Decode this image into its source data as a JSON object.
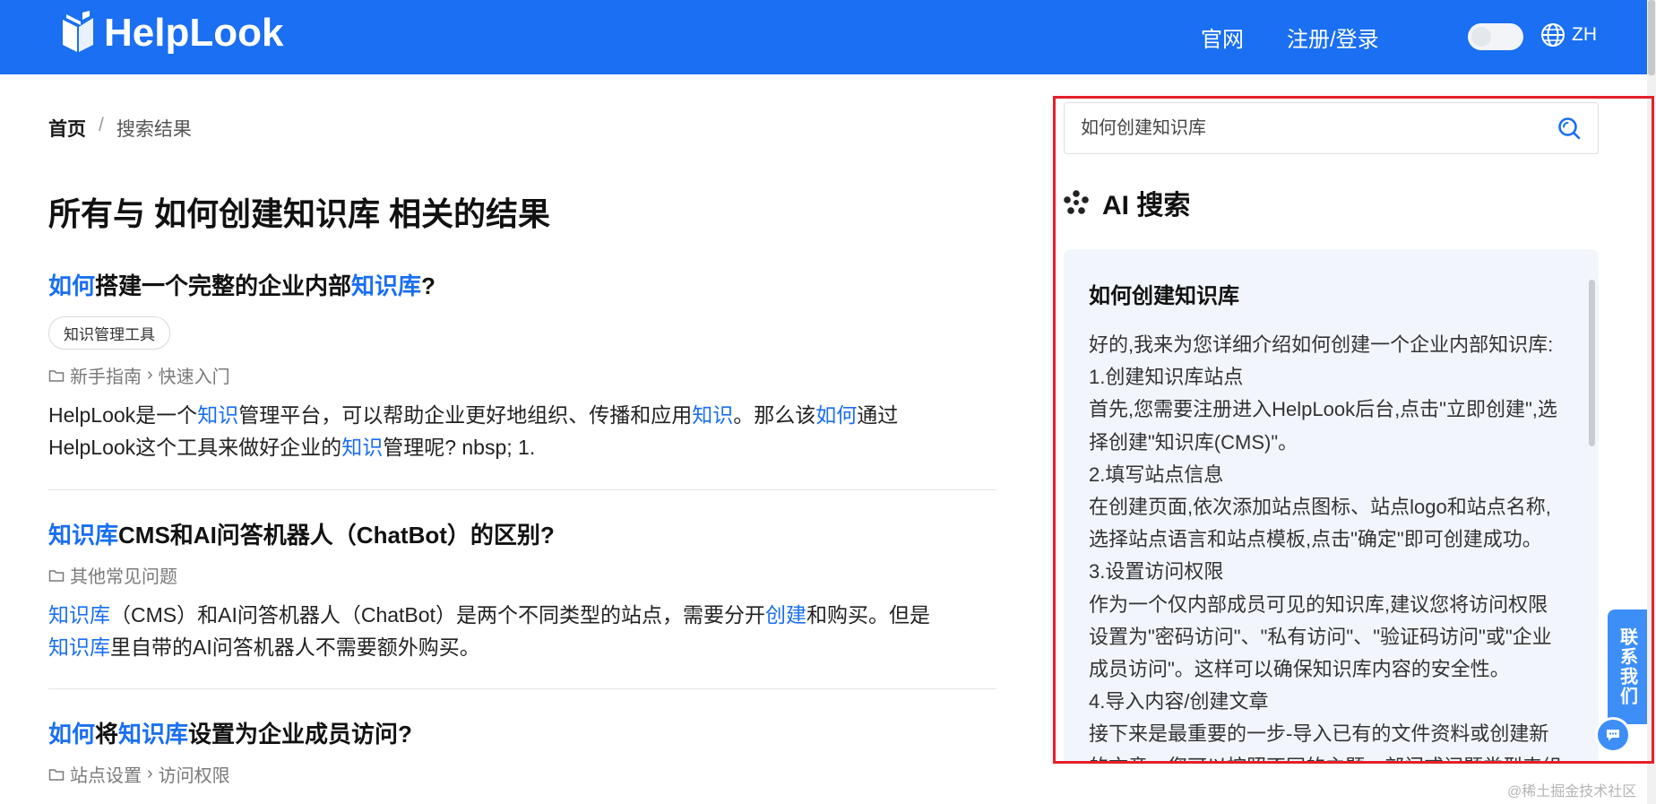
{
  "header": {
    "logo_text": "HelpLook",
    "nav_official": "官网",
    "nav_login": "注册/登录",
    "lang": "ZH",
    "brand_color": "#1a6ff2"
  },
  "breadcrumb": {
    "home": "首页",
    "separator": "/",
    "current": "搜索结果"
  },
  "page_title": "所有与 如何创建知识库 相关的结果",
  "results": [
    {
      "title_parts": [
        {
          "text": "如何",
          "highlight": true
        },
        {
          "text": "搭建一个完整的企业内部",
          "highlight": false
        },
        {
          "text": "知识库",
          "highlight": true
        },
        {
          "text": "?",
          "highlight": false
        }
      ],
      "tag": "知识管理工具",
      "path": [
        "新手指南",
        "快速入门"
      ],
      "snippet_lines": [
        [
          {
            "text": "HelpLook是一个",
            "highlight": false
          },
          {
            "text": "知识",
            "highlight": true
          },
          {
            "text": "管理平台，可以帮助企业更好地组织、传播和应用",
            "highlight": false
          },
          {
            "text": "知识",
            "highlight": true
          },
          {
            "text": "。那么该",
            "highlight": false
          },
          {
            "text": "如何",
            "highlight": true
          },
          {
            "text": "通过",
            "highlight": false
          }
        ],
        [
          {
            "text": "HelpLook这个工具来做好企业的",
            "highlight": false
          },
          {
            "text": "知识",
            "highlight": true
          },
          {
            "text": "管理呢?   nbsp; 1.",
            "highlight": false
          }
        ]
      ]
    },
    {
      "title_parts": [
        {
          "text": "知识库",
          "highlight": true
        },
        {
          "text": "CMS和AI问答机器人（ChatBot）的区别?",
          "highlight": false
        }
      ],
      "tag": "",
      "path": [
        "其他常见问题"
      ],
      "snippet_lines": [
        [
          {
            "text": "知识库",
            "highlight": true
          },
          {
            "text": "（CMS）和AI问答机器人（ChatBot）是两个不同类型的站点，需要分开",
            "highlight": false
          },
          {
            "text": "创建",
            "highlight": true
          },
          {
            "text": "和购买。但是",
            "highlight": false
          }
        ],
        [
          {
            "text": "知识库",
            "highlight": true
          },
          {
            "text": "里自带的AI问答机器人不需要额外购买。",
            "highlight": false
          }
        ]
      ]
    },
    {
      "title_parts": [
        {
          "text": "如何",
          "highlight": true
        },
        {
          "text": "将",
          "highlight": false
        },
        {
          "text": "知识库",
          "highlight": true
        },
        {
          "text": "设置为企业成员访问?",
          "highlight": false
        }
      ],
      "tag": "",
      "path": [
        "站点设置",
        "访问权限"
      ],
      "snippet_lines": []
    }
  ],
  "search": {
    "value": "如何创建知识库",
    "placeholder": ""
  },
  "ai": {
    "heading": "AI 搜索",
    "card_title": "如何创建知识库",
    "lines": [
      "好的,我来为您详细介绍如何创建一个企业内部知识库:",
      "1.创建知识库站点",
      "首先,您需要注册进入HelpLook后台,点击\"立即创建\",选",
      "择创建\"知识库(CMS)\"。",
      "2.填写站点信息",
      "在创建页面,依次添加站点图标、站点logo和站点名称,",
      "选择站点语言和站点模板,点击\"确定\"即可创建成功。",
      "3.设置访问权限",
      "作为一个仅内部成员可见的知识库,建议您将访问权限",
      "设置为\"密码访问\"、\"私有访问\"、\"验证码访问\"或\"企业",
      "成员访问\"。这样可以确保知识库内容的安全性。",
      "4.导入内容/创建文章",
      "接下来是最重要的一步-导入已有的文件资料或创建新",
      "的文章，您可以按照不同的主题、部门或问题类型来组"
    ]
  },
  "contact_tab": "联系我们",
  "watermark": "@稀土掘金技术社区",
  "colors": {
    "highlight": "#1a6ff2",
    "panel_border": "#e5202a",
    "ai_card_bg": "#f2f6fc"
  }
}
